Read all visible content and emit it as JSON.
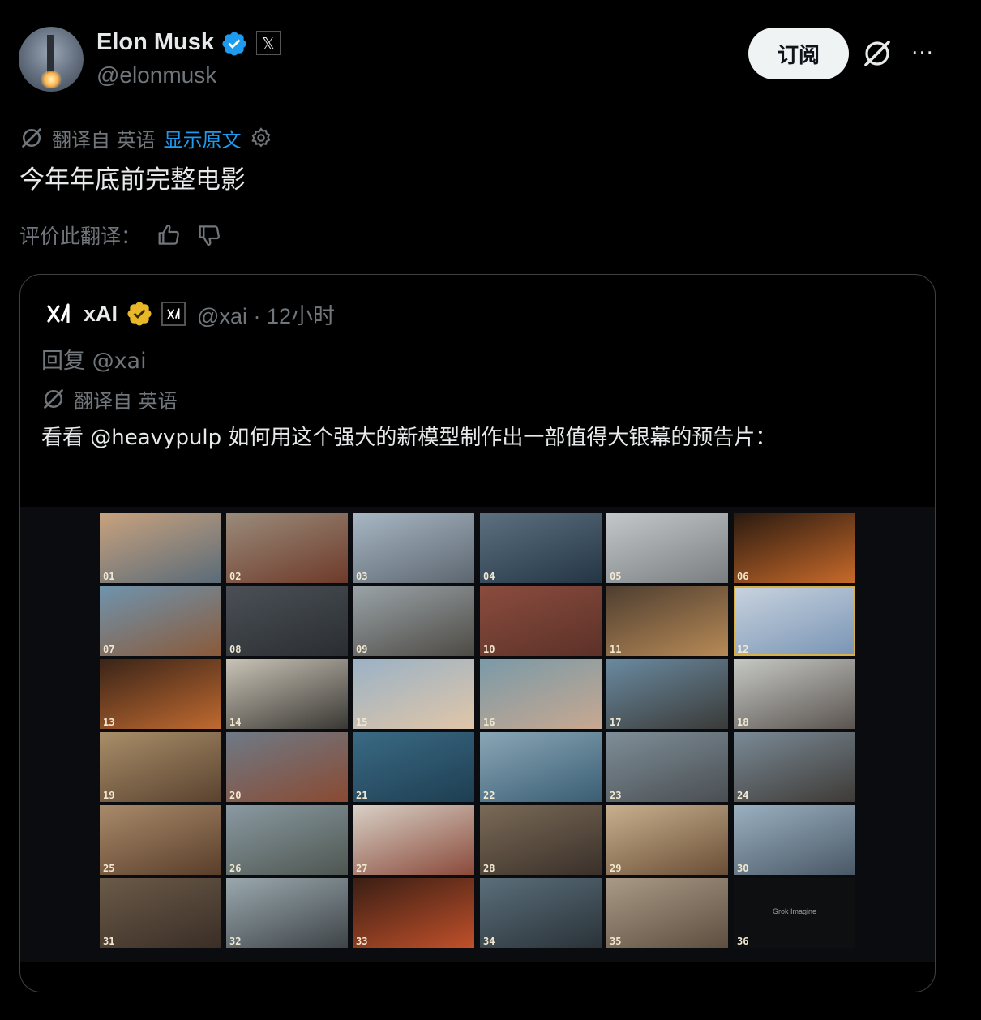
{
  "author": {
    "name": "Elon Musk",
    "handle": "@elonmusk",
    "verified_icon": "verified-badge-icon",
    "affiliate_icon": "x-logo-icon",
    "affiliate_glyph": "𝕏"
  },
  "actions": {
    "subscribe_label": "订阅",
    "grok_icon": "grok-icon",
    "more_icon": "more-dots-icon",
    "more_glyph": "···"
  },
  "translation": {
    "translated_from": "翻译自 英语",
    "show_original": "显示原文",
    "settings_icon": "gear-icon"
  },
  "tweet_text": "今年年底前完整电影",
  "rating": {
    "label": "评价此翻译：",
    "up_icon": "thumbs-up-icon",
    "down_icon": "thumbs-down-icon"
  },
  "quote": {
    "name": "xAI",
    "meta": "@xai · 12小时",
    "reply_to": "回复 @xai",
    "translated_from": "翻译自 英语",
    "text": "看看 @heavypulp 如何用这个强大的新模型制作出一部值得大银幕的预告片：",
    "gold_badge_icon": "gold-verified-badge-icon",
    "logo_icon": "xai-logo-icon"
  },
  "media": {
    "thumbnails": [
      {
        "num": "01",
        "c1": "#c8a27e",
        "c2": "#5a6b78"
      },
      {
        "num": "02",
        "c1": "#9a8b7a",
        "c2": "#6e3a2a"
      },
      {
        "num": "03",
        "c1": "#a7b7c4",
        "c2": "#5d6670"
      },
      {
        "num": "04",
        "c1": "#5d7080",
        "c2": "#243645"
      },
      {
        "num": "05",
        "c1": "#c2c7c9",
        "c2": "#7a7e80"
      },
      {
        "num": "06",
        "c1": "#2a1a10",
        "c2": "#c86a2a"
      },
      {
        "num": "07",
        "c1": "#6f93ad",
        "c2": "#8a5a3a"
      },
      {
        "num": "08",
        "c1": "#4a5056",
        "c2": "#2a2e32"
      },
      {
        "num": "09",
        "c1": "#9aa3a8",
        "c2": "#4d4a44"
      },
      {
        "num": "10",
        "c1": "#8a4c3e",
        "c2": "#5c3128"
      },
      {
        "num": "11",
        "c1": "#4e3e30",
        "c2": "#b88a56"
      },
      {
        "num": "12",
        "c1": "#c9d3df",
        "c2": "#7894b4"
      },
      {
        "num": "13",
        "c1": "#3a2418",
        "c2": "#c06a30"
      },
      {
        "num": "14",
        "c1": "#c9c3b6",
        "c2": "#3a3834"
      },
      {
        "num": "15",
        "c1": "#9ab2c6",
        "c2": "#e0c6a8"
      },
      {
        "num": "16",
        "c1": "#7a9aa8",
        "c2": "#c8a890"
      },
      {
        "num": "17",
        "c1": "#6a8aa0",
        "c2": "#3a3a38"
      },
      {
        "num": "18",
        "c1": "#c6c8c4",
        "c2": "#5a5450"
      },
      {
        "num": "19",
        "c1": "#a88e68",
        "c2": "#5a4230"
      },
      {
        "num": "20",
        "c1": "#6e7a86",
        "c2": "#8a4a32"
      },
      {
        "num": "21",
        "c1": "#3a6a84",
        "c2": "#1e3e52"
      },
      {
        "num": "22",
        "c1": "#8aa6b6",
        "c2": "#3a5e74"
      },
      {
        "num": "23",
        "c1": "#7e8e98",
        "c2": "#4a4e52"
      },
      {
        "num": "24",
        "c1": "#7a8a96",
        "c2": "#3e3a36"
      },
      {
        "num": "25",
        "c1": "#a88a6a",
        "c2": "#5a3e2a"
      },
      {
        "num": "26",
        "c1": "#8a9aa2",
        "c2": "#4e5650"
      },
      {
        "num": "27",
        "c1": "#d8d0c6",
        "c2": "#8a4a3a"
      },
      {
        "num": "28",
        "c1": "#7a6a56",
        "c2": "#3a302a"
      },
      {
        "num": "29",
        "c1": "#c8b08e",
        "c2": "#6a4e36"
      },
      {
        "num": "30",
        "c1": "#9ab0c0",
        "c2": "#4a5866"
      },
      {
        "num": "31",
        "c1": "#6a5a48",
        "c2": "#3a2e26"
      },
      {
        "num": "32",
        "c1": "#9aa8ae",
        "c2": "#3e4448"
      },
      {
        "num": "33",
        "c1": "#3a1e14",
        "c2": "#c0502a"
      },
      {
        "num": "34",
        "c1": "#5a6e7a",
        "c2": "#2a3238"
      },
      {
        "num": "35",
        "c1": "#a89a86",
        "c2": "#5e4e40"
      },
      {
        "num": "36",
        "c1": "#0e0f10",
        "c2": "#0e0f10",
        "label": "Grok Imagine"
      }
    ],
    "selected": "12"
  }
}
